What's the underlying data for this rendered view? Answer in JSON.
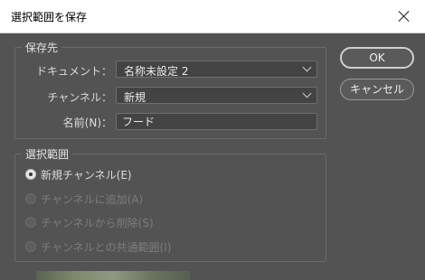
{
  "window": {
    "title": "選択範囲を保存"
  },
  "destination": {
    "group_label": "保存先",
    "document_label": "ドキュメント：",
    "document_value": "名称未設定 2",
    "channel_label": "チャンネル：",
    "channel_value": "新規",
    "name_label": "名前(N)：",
    "name_value": "フード"
  },
  "operation": {
    "group_label": "選択範囲",
    "options": [
      {
        "label": "新規チャンネル(E)",
        "checked": true,
        "enabled": true
      },
      {
        "label": "チャンネルに追加(A)",
        "checked": false,
        "enabled": false
      },
      {
        "label": "チャンネルから削除(S)",
        "checked": false,
        "enabled": false
      },
      {
        "label": "チャンネルとの共通範囲(I)",
        "checked": false,
        "enabled": false
      }
    ]
  },
  "buttons": {
    "ok_label": "OK",
    "cancel_label": "キャンセル"
  }
}
